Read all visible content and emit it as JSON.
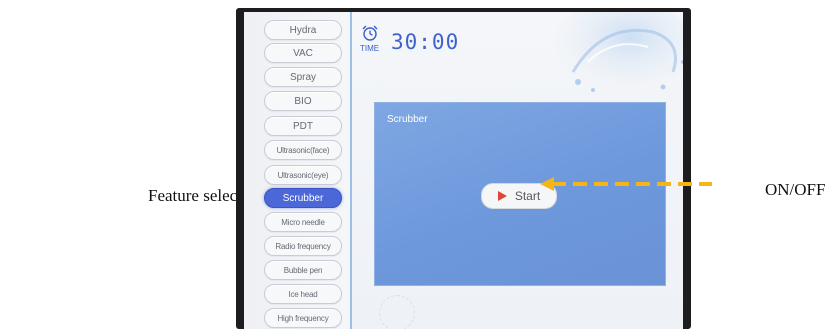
{
  "annotations": {
    "left_label": "Feature selection",
    "right_label": "ON/OFF",
    "arrow_color": "#f5b418"
  },
  "sidebar": {
    "items": [
      {
        "label": "Hydra",
        "active": false
      },
      {
        "label": "VAC",
        "active": false
      },
      {
        "label": "Spray",
        "active": false
      },
      {
        "label": "BIO",
        "active": false
      },
      {
        "label": "PDT",
        "active": false
      },
      {
        "label": "Ultrasonic(face)",
        "active": false
      },
      {
        "label": "Ultrasonic(eye)",
        "active": false
      },
      {
        "label": "Scrubber",
        "active": true
      },
      {
        "label": "Micro needle",
        "active": false
      },
      {
        "label": "Radio frequency",
        "active": false
      },
      {
        "label": "Bubble pen",
        "active": false
      },
      {
        "label": "Ice head",
        "active": false
      },
      {
        "label": "High frequency",
        "active": false
      }
    ]
  },
  "header": {
    "time_label": "TIME",
    "time_value": "30:00",
    "clock_icon": "alarm-clock-icon"
  },
  "panel": {
    "title": "Scrubber",
    "start_label": "Start",
    "start_icon": "play-icon"
  },
  "colors": {
    "accent": "#4b67d8",
    "panel": "#7ea7e2",
    "time": "#3d63cf",
    "play": "#d9483b"
  }
}
